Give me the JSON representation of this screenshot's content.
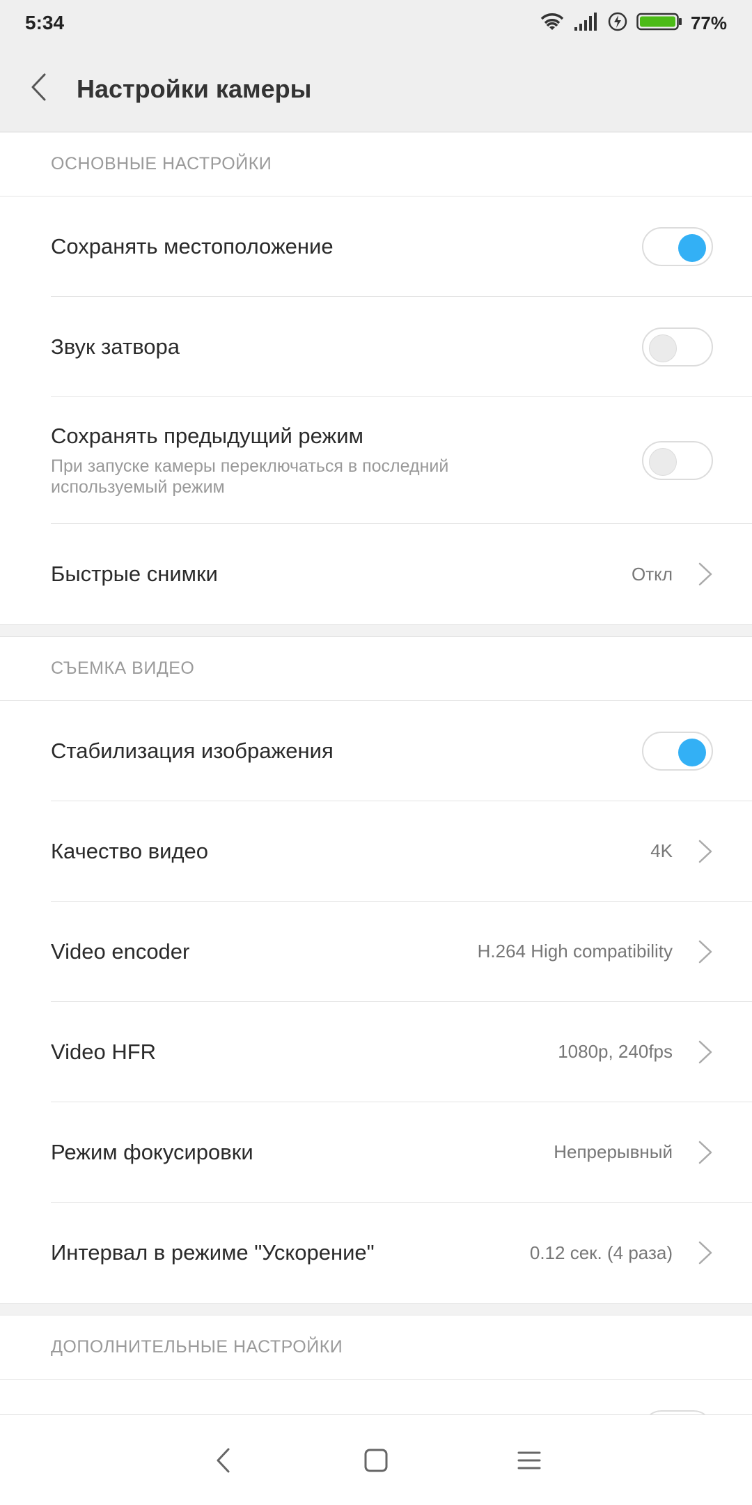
{
  "status": {
    "time": "5:34",
    "battery": "77%"
  },
  "appbar": {
    "title": "Настройки камеры"
  },
  "sections": {
    "basic": {
      "header": "ОСНОВНЫЕ НАСТРОЙКИ",
      "save_location": {
        "label": "Сохранять местоположение",
        "on": true
      },
      "shutter_sound": {
        "label": "Звук затвора",
        "on": false
      },
      "save_prev_mode": {
        "label": "Сохранять предыдущий режим",
        "sub": "При запуске камеры переключаться в последний используемый режим",
        "on": false
      },
      "quick_shots": {
        "label": "Быстрые снимки",
        "value": "Откл"
      }
    },
    "video": {
      "header": "СЪЕМКА ВИДЕО",
      "stabilization": {
        "label": "Стабилизация изображения",
        "on": true
      },
      "quality": {
        "label": "Качество видео",
        "value": "4K"
      },
      "encoder": {
        "label": "Video encoder",
        "value": "H.264 High compatibility"
      },
      "hfr": {
        "label": "Video HFR",
        "value": "1080p, 240fps"
      },
      "focus_mode": {
        "label": "Режим фокусировки",
        "value": "Непрерывный"
      },
      "timelapse": {
        "label": "Интервал в режиме \"Ускорение\"",
        "value": "0.12 сек. (4 раза)"
      }
    },
    "extra": {
      "header": "ДОПОЛНИТЕЛЬНЫЕ НАСТРОЙКИ"
    }
  },
  "colors": {
    "accent": "#33b0f5",
    "background": "#f2f2f2"
  }
}
